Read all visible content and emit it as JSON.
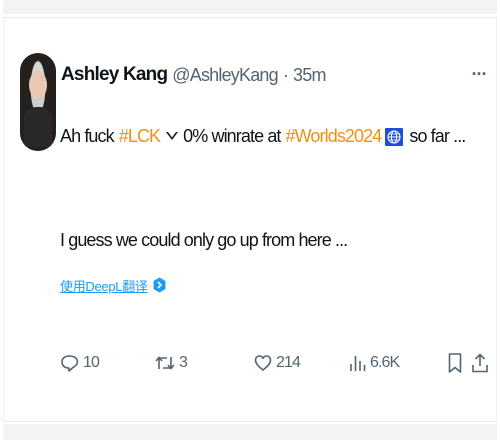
{
  "tweet": {
    "author_name": "Ashley Kang",
    "author_handle": "@AshleyKang",
    "separator": "·",
    "time": "35m",
    "more_label": "···",
    "text_part1": "Ah fuck",
    "hashtag1": "#LCK",
    "text_part2": "0% winrate at",
    "hashtag2": "#Worlds2024",
    "text_part3": "so far ...",
    "text_line2": "I guess we could only go up from here ...",
    "translate_label": "使用DeepL翻译",
    "replies": "10",
    "reposts": "3",
    "likes": "214",
    "views": "6.6K"
  },
  "colors": {
    "accent": "#1d9bf0",
    "hashtag": "#f4900c",
    "secondary_text": "#536471",
    "primary_text": "#0f1419",
    "globe_box": "#1d4ed8"
  },
  "icons": {
    "chevron": "chevron-down-icon",
    "globe": "globe-icon",
    "translate": "translate-icon",
    "reply": "reply-icon",
    "repost": "repost-icon",
    "like": "heart-icon",
    "views": "views-icon",
    "bookmark": "bookmark-icon",
    "share": "share-icon"
  }
}
